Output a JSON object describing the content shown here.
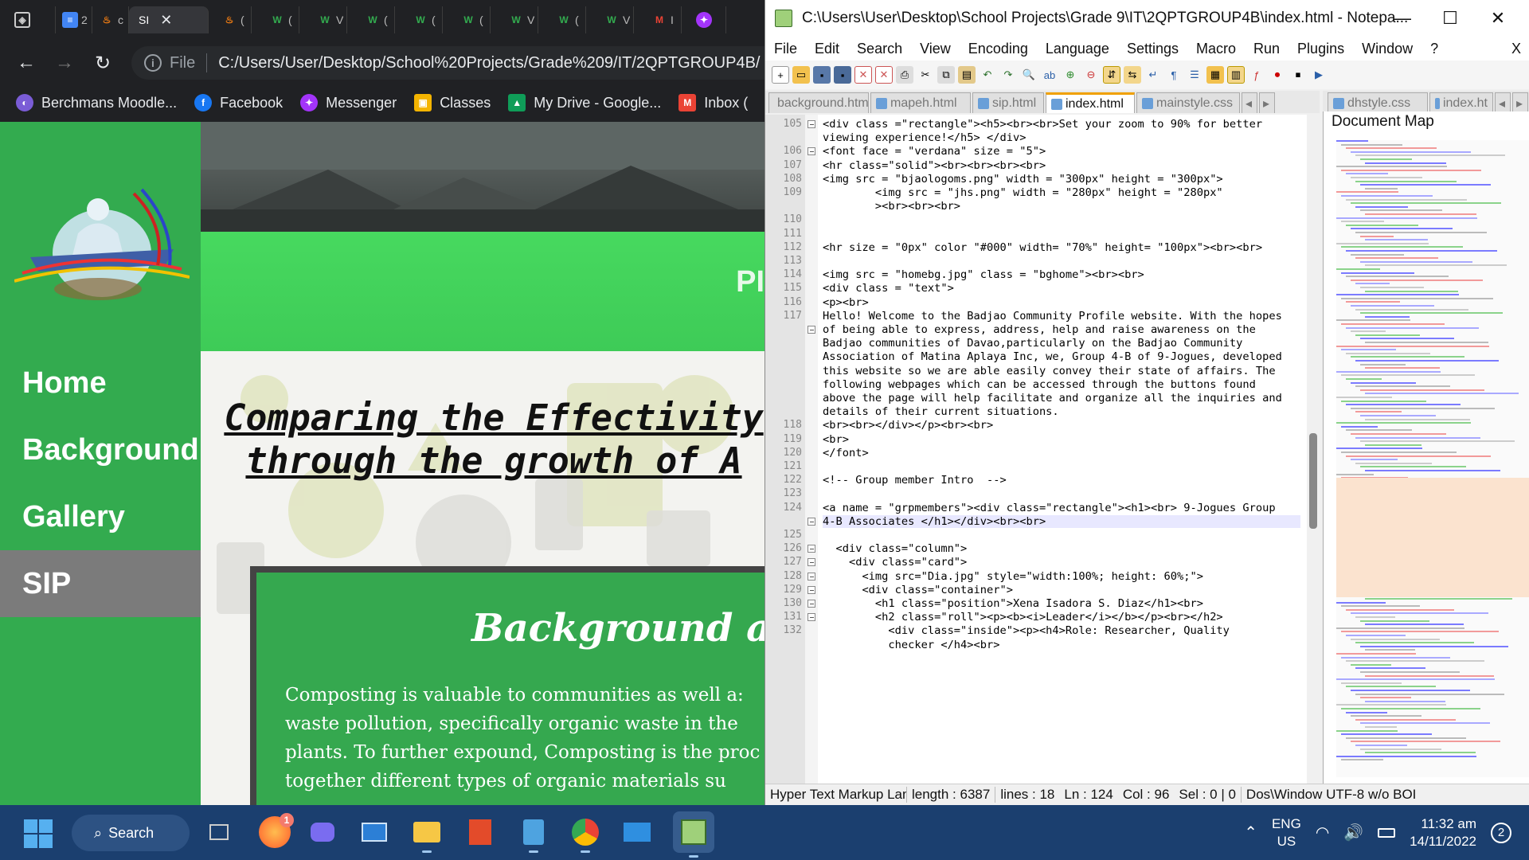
{
  "chrome": {
    "tabs": [
      {
        "icon": "notion-icon",
        "label": ""
      },
      {
        "icon": "docs-icon",
        "label": "2"
      },
      {
        "icon": "moodle-icon",
        "label": "c"
      },
      {
        "icon": "",
        "label": "SI"
      },
      {
        "icon": "moodle-icon",
        "label": "("
      },
      {
        "icon": "w-icon",
        "label": "("
      },
      {
        "icon": "w-icon",
        "label": "V"
      },
      {
        "icon": "w-icon",
        "label": "("
      },
      {
        "icon": "w-icon",
        "label": "("
      },
      {
        "icon": "w-icon",
        "label": "("
      },
      {
        "icon": "w-icon",
        "label": "V"
      },
      {
        "icon": "w-icon",
        "label": "("
      },
      {
        "icon": "w-icon",
        "label": "V"
      },
      {
        "icon": "gmail-icon",
        "label": "I"
      },
      {
        "icon": "messenger-icon",
        "label": ""
      }
    ],
    "omnibox": {
      "scheme": "File",
      "url": "C:/Users/User/Desktop/School%20Projects/Grade%209/IT/2QPTGROUP4B/"
    },
    "bookmarks": [
      {
        "label": "Berchmans Moodle...",
        "color": "#7a5cd6"
      },
      {
        "label": "Facebook",
        "color": "#1877f2"
      },
      {
        "label": "Messenger",
        "color": "#a334fa"
      },
      {
        "label": "Classes",
        "color": "#f4b400"
      },
      {
        "label": "My Drive - Google...",
        "color": "#0f9d58"
      },
      {
        "label": "Inbox (",
        "color": "#ea4335"
      }
    ]
  },
  "site": {
    "nav": [
      "Home",
      "Background",
      "Gallery",
      "SIP"
    ],
    "active_nav": "SIP",
    "hero_text": "PI",
    "title_line1": "Comparing the Effectivity",
    "title_line2": "through the growth of A",
    "card_heading": "Background and",
    "card_lines": [
      "Composting is valuable to communities as well a:",
      "waste pollution, specifically organic waste in the",
      "plants. To further expound, Composting is the proc",
      "together different types of organic materials su"
    ],
    "colors": {
      "sidebar": "#33ab4f",
      "band": "#47d95f",
      "card": "#35a84f"
    }
  },
  "npp": {
    "title": "C:\\Users\\User\\Desktop\\School Projects\\Grade 9\\IT\\2QPTGROUP4B\\index.html - Notepa...",
    "menu": [
      "File",
      "Edit",
      "Search",
      "View",
      "Encoding",
      "Language",
      "Settings",
      "Macro",
      "Run",
      "Plugins",
      "Window",
      "?"
    ],
    "menu_close": "X",
    "tabs": [
      "background.html",
      "mapeh.html",
      "sip.html",
      "index.html",
      "mainstyle.css"
    ],
    "active_tab": "index.html",
    "tabs2": [
      "dhstyle.css",
      "index.ht"
    ],
    "doc_map_title": "Document Map",
    "status": {
      "lang": "Hyper Text Markup Langua",
      "length": "length : 6387",
      "lines": "lines : 18",
      "ln": "Ln : 124",
      "col": "Col : 96",
      "sel": "Sel : 0 | 0",
      "eol": "Dos\\Window UTF-8 w/o BOI"
    },
    "line_numbers": [
      "105",
      "",
      "106",
      "107",
      "108",
      "109",
      "",
      "110",
      "111",
      "112",
      "113",
      "114",
      "115",
      "116",
      "117",
      "",
      "",
      "",
      "",
      "",
      "",
      "",
      "118",
      "119",
      "120",
      "121",
      "122",
      "123",
      "124",
      "",
      "125",
      "126",
      "127",
      "128",
      "129",
      "130",
      "131",
      "132",
      ""
    ],
    "code": [
      "<div class =\"rectangle\"><h5><br><br>Set your zoom to 90% for better",
      "viewing experience!</h5> </div>",
      "<font face = \"verdana\" size = \"5\">",
      "<hr class=\"solid\"><br><br><br><br>",
      "<img src = \"bjaologoms.png\" width = \"300px\" height = \"300px\">",
      "        <img src = \"jhs.png\" width = \"280px\" height = \"280px\"",
      "        ><br><br><br>",
      "",
      "",
      "<hr size = \"0px\" color \"#000\" width= \"70%\" height= \"100px\"><br><br>",
      "",
      "<img src = \"homebg.jpg\" class = \"bghome\"><br><br>",
      "<div class = \"text\">",
      "<p><br>",
      "Hello! Welcome to the Badjao Community Profile website. With the hopes",
      "of being able to express, address, help and raise awareness on the",
      "Badjao communities of Davao,particularly on the Badjao Community",
      "Association of Matina Aplaya Inc, we, Group 4-B of 9-Jogues, developed",
      "this website so we are able easily convey their state of affairs. The",
      "following webpages which can be accessed through the buttons found",
      "above the page will help facilitate and organize all the inquiries and",
      "details of their current situations.",
      "<br><br></div></p><br><br>",
      "<br>",
      "</font>",
      "",
      "<!-- Group member Intro  -->",
      "",
      "<a name = \"grpmembers\"><div class=\"rectangle\"><h1><br> 9-Jogues Group",
      "4-B Associates </h1></div><br><br>",
      "",
      "  <div class=\"column\">",
      "    <div class=\"card\">",
      "      <img src=\"Dia.jpg\" style=\"width:100%; height: 60%;\">",
      "      <div class=\"container\">",
      "        <h1 class=\"position\">Xena Isadora S. Diaz</h1><br>",
      "        <h2 class=\"roll\"><p><b><i>Leader</i></b></p><br></h2>",
      "          <div class=\"inside\"><p><h4>Role: Researcher, Quality",
      "          checker </h4><br>"
    ]
  },
  "taskbar": {
    "search": "Search",
    "lang1": "ENG",
    "lang2": "US",
    "time": "11:32 am",
    "date": "14/11/2022",
    "notif_count": "2",
    "apps": [
      "task-view",
      "firefox",
      "meet",
      "photos",
      "explorer",
      "office",
      "notepad",
      "chrome",
      "mail",
      "notepadpp"
    ],
    "firefox_badge": "1"
  }
}
